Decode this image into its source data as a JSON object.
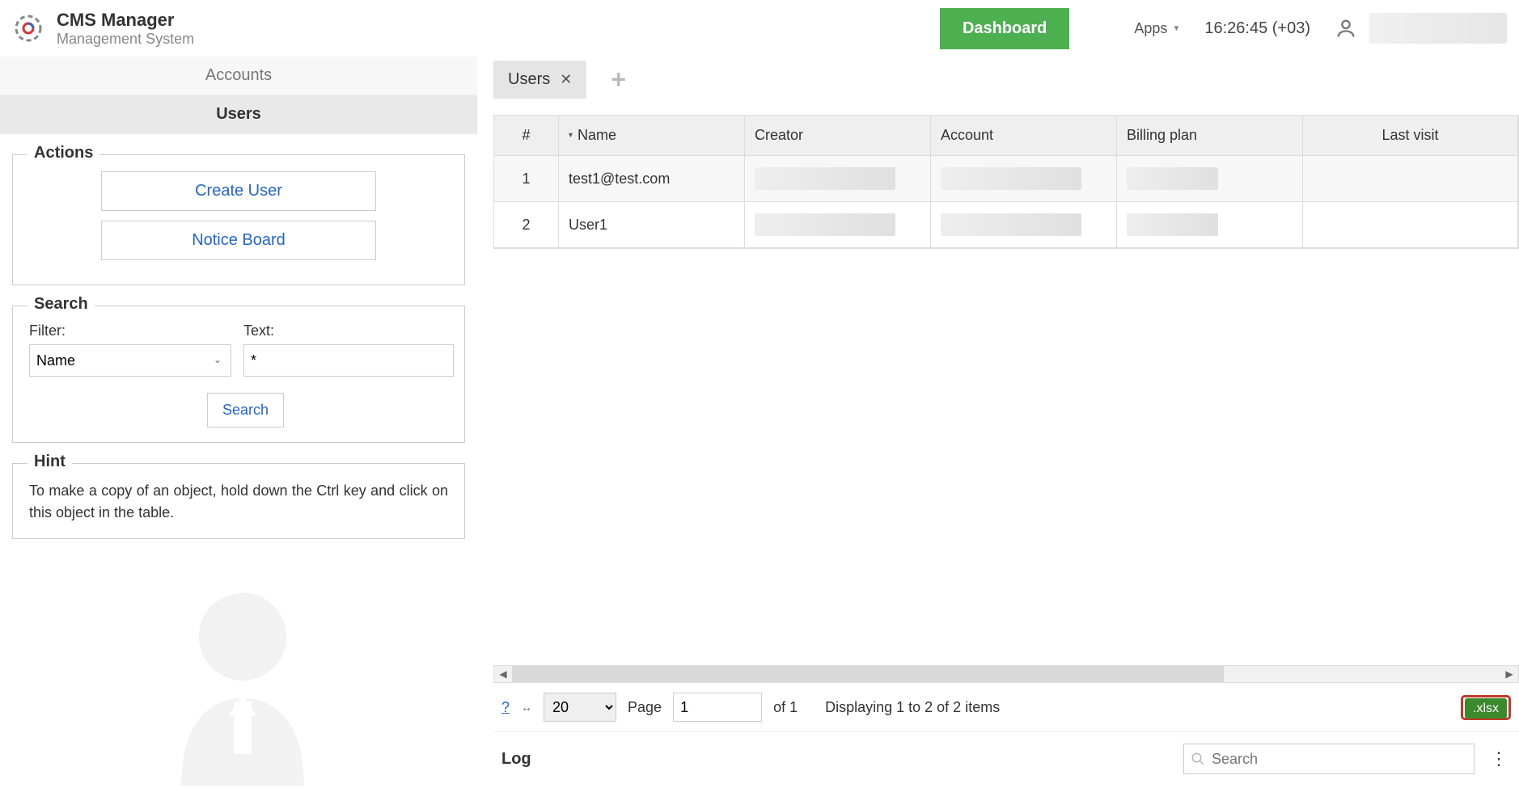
{
  "header": {
    "app_title": "CMS Manager",
    "app_subtitle": "Management System",
    "dashboard_label": "Dashboard",
    "apps_label": "Apps",
    "clock": "16:26:45 (+03)"
  },
  "sidebar": {
    "nav": [
      "Accounts",
      "Users"
    ],
    "active_nav_index": 1,
    "actions": {
      "title": "Actions",
      "buttons": [
        "Create User",
        "Notice Board"
      ]
    },
    "search": {
      "title": "Search",
      "filter_label": "Filter:",
      "filter_value": "Name",
      "text_label": "Text:",
      "text_value": "*",
      "search_label": "Search"
    },
    "hint": {
      "title": "Hint",
      "text": "To make a copy of an object, hold down the Ctrl key and click on this object in the table."
    }
  },
  "tabs": {
    "open": [
      "Users"
    ]
  },
  "table": {
    "columns": [
      "#",
      "Name",
      "Creator",
      "Account",
      "Billing plan",
      "Last visit"
    ],
    "sort_column": "Name",
    "rows": [
      {
        "idx": "1",
        "name": "test1@test.com"
      },
      {
        "idx": "2",
        "name": "User1"
      }
    ]
  },
  "pager": {
    "page_size": "20",
    "page_label": "Page",
    "page_value": "1",
    "of_label": "of 1",
    "displaying": "Displaying 1 to 2 of 2 items",
    "xlsx_label": ".xlsx"
  },
  "log": {
    "label": "Log",
    "search_placeholder": "Search"
  }
}
